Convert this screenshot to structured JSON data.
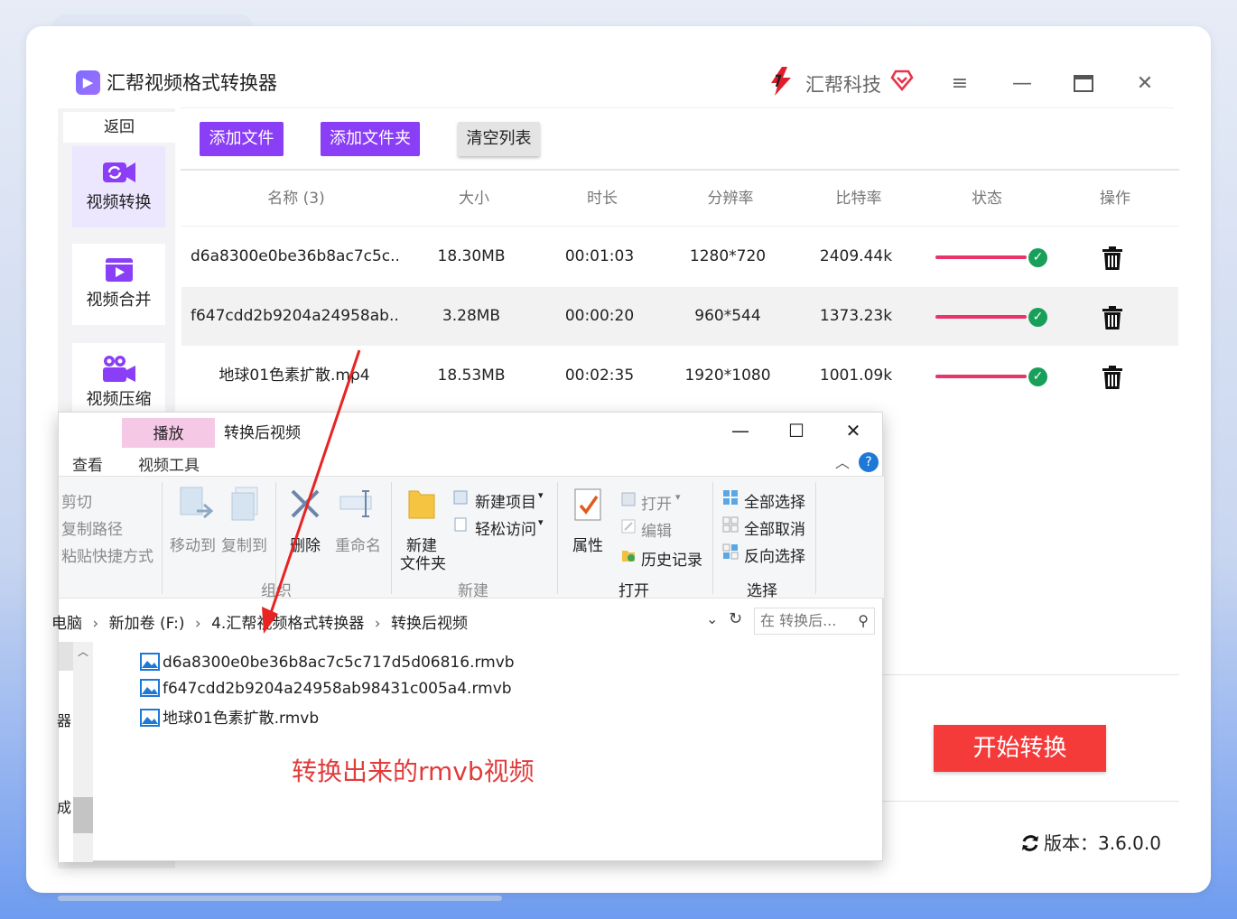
{
  "app": {
    "title": "汇帮视频格式转换器",
    "brand": "汇帮科技",
    "back_label": "返回",
    "nav": [
      {
        "label": "视频转换",
        "active": true
      },
      {
        "label": "视频合并",
        "active": false
      },
      {
        "label": "视频压缩",
        "active": false
      }
    ],
    "toolbar": {
      "add_file": "添加文件",
      "add_folder": "添加文件夹",
      "clear_list": "清空列表"
    },
    "table": {
      "headers": [
        "名称 (3)",
        "大小",
        "时长",
        "分辨率",
        "比特率",
        "状态",
        "操作"
      ],
      "rows": [
        {
          "name": "d6a8300e0be36b8ac7c5c...",
          "size": "18.30MB",
          "duration": "00:01:03",
          "resolution": "1280*720",
          "bitrate": "2409.44k",
          "progress": 1.0
        },
        {
          "name": "f647cdd2b9204a24958ab...",
          "size": "3.28MB",
          "duration": "00:00:20",
          "resolution": "960*544",
          "bitrate": "1373.23k",
          "progress": 1.0
        },
        {
          "name": "地球01色素扩散.mp4",
          "size": "18.53MB",
          "duration": "00:02:35",
          "resolution": "1920*1080",
          "bitrate": "1001.09k",
          "progress": 1.0
        }
      ]
    },
    "start_button": "开始转换",
    "version": "版本：3.6.0.0",
    "colors": {
      "accent": "#8a3ef5",
      "start": "#f53a3a",
      "progress": "#e8336b",
      "done": "#18a05a"
    }
  },
  "explorer": {
    "play_tab": "播放",
    "title": "转换后视频",
    "tabs": [
      "查看",
      "视频工具"
    ],
    "ribbon": {
      "clipboard": [
        "剪切",
        "复制路径",
        "粘贴快捷方式"
      ],
      "move_to": "移动到",
      "copy_to": "复制到",
      "delete": "删除",
      "rename": "重命名",
      "organize_group": "组织",
      "new_folder_line1": "新建",
      "new_folder_line2": "文件夹",
      "new_item": "新建项目",
      "easy_access": "轻松访问",
      "new_group": "新建",
      "properties": "属性",
      "open": "打开",
      "edit": "编辑",
      "history": "历史记录",
      "open_group": "打开",
      "select_all": "全部选择",
      "select_none": "全部取消",
      "invert_select": "反向选择",
      "select_group": "选择"
    },
    "address": [
      "电脑",
      "新加卷 (F:)",
      "4.汇帮视频格式转换器",
      "转换后视频"
    ],
    "search_placeholder": "在 转换后...",
    "nav_fragments": [
      "器",
      "成影"
    ],
    "files": [
      "d6a8300e0be36b8ac7c5c717d5d06816.rmvb",
      "f647cdd2b9204a24958ab98431c005a4.rmvb",
      "地球01色素扩散.rmvb"
    ]
  },
  "annotation": "转换出来的rmvb视频"
}
